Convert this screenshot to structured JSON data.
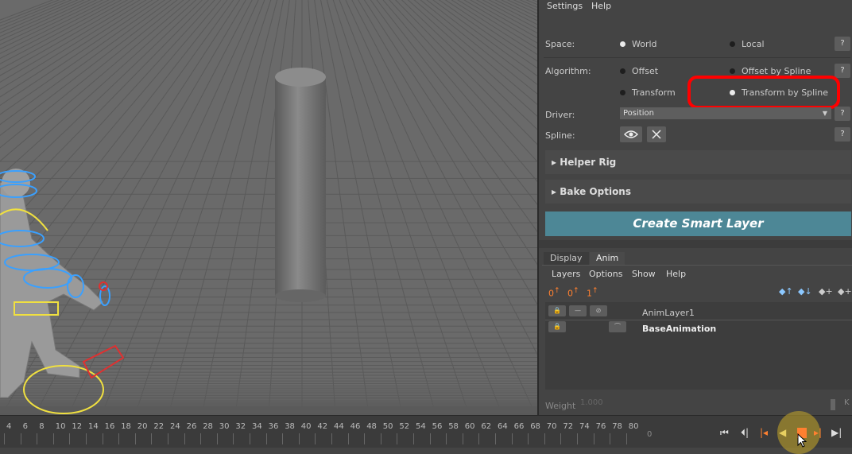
{
  "menubar": {
    "settings": "Settings",
    "help": "Help"
  },
  "space": {
    "label": "Space:",
    "opt1": "World",
    "opt2": "Local",
    "q": "?"
  },
  "algorithm": {
    "label": "Algorithm:",
    "opt1": "Offset",
    "opt2": "Offset by Spline",
    "opt3": "Transform",
    "opt4": "Transform by Spline",
    "q": "?"
  },
  "driver": {
    "label": "Driver:",
    "value": "Position",
    "q": "?"
  },
  "spline": {
    "label": "Spline:",
    "q": "?"
  },
  "sections": {
    "helper_rig": "Helper Rig",
    "bake_options": "Bake Options"
  },
  "create_button": "Create Smart Layer",
  "tabs": {
    "display": "Display",
    "anim": "Anim"
  },
  "layer_menu": {
    "layers": "Layers",
    "options": "Options",
    "show": "Show",
    "help": "Help"
  },
  "layer_tools": {
    "t1": "0",
    "t2": "0",
    "t3": "1"
  },
  "layers": {
    "anim_layer": "AnimLayer1",
    "base_animation": "BaseAnimation"
  },
  "weight": {
    "label": "Weight",
    "value": "1.000",
    "k": "K"
  },
  "timeline": {
    "ticks": [
      "4",
      "6",
      "8",
      "10",
      "12",
      "14",
      "16",
      "18",
      "20",
      "22",
      "24",
      "26",
      "28",
      "30",
      "32",
      "34",
      "36",
      "38",
      "40",
      "42",
      "44",
      "46",
      "48",
      "50",
      "52",
      "54",
      "56",
      "58",
      "60",
      "62",
      "64",
      "66",
      "68",
      "70",
      "72",
      "74",
      "76",
      "78",
      "80"
    ],
    "current_frame": "0"
  },
  "colors": {
    "accent": "#4d8796",
    "highlight": "#ff0000",
    "rig_blue": "#3aa0ff",
    "rig_yellow": "#f0e040",
    "rig_red": "#e03030"
  }
}
